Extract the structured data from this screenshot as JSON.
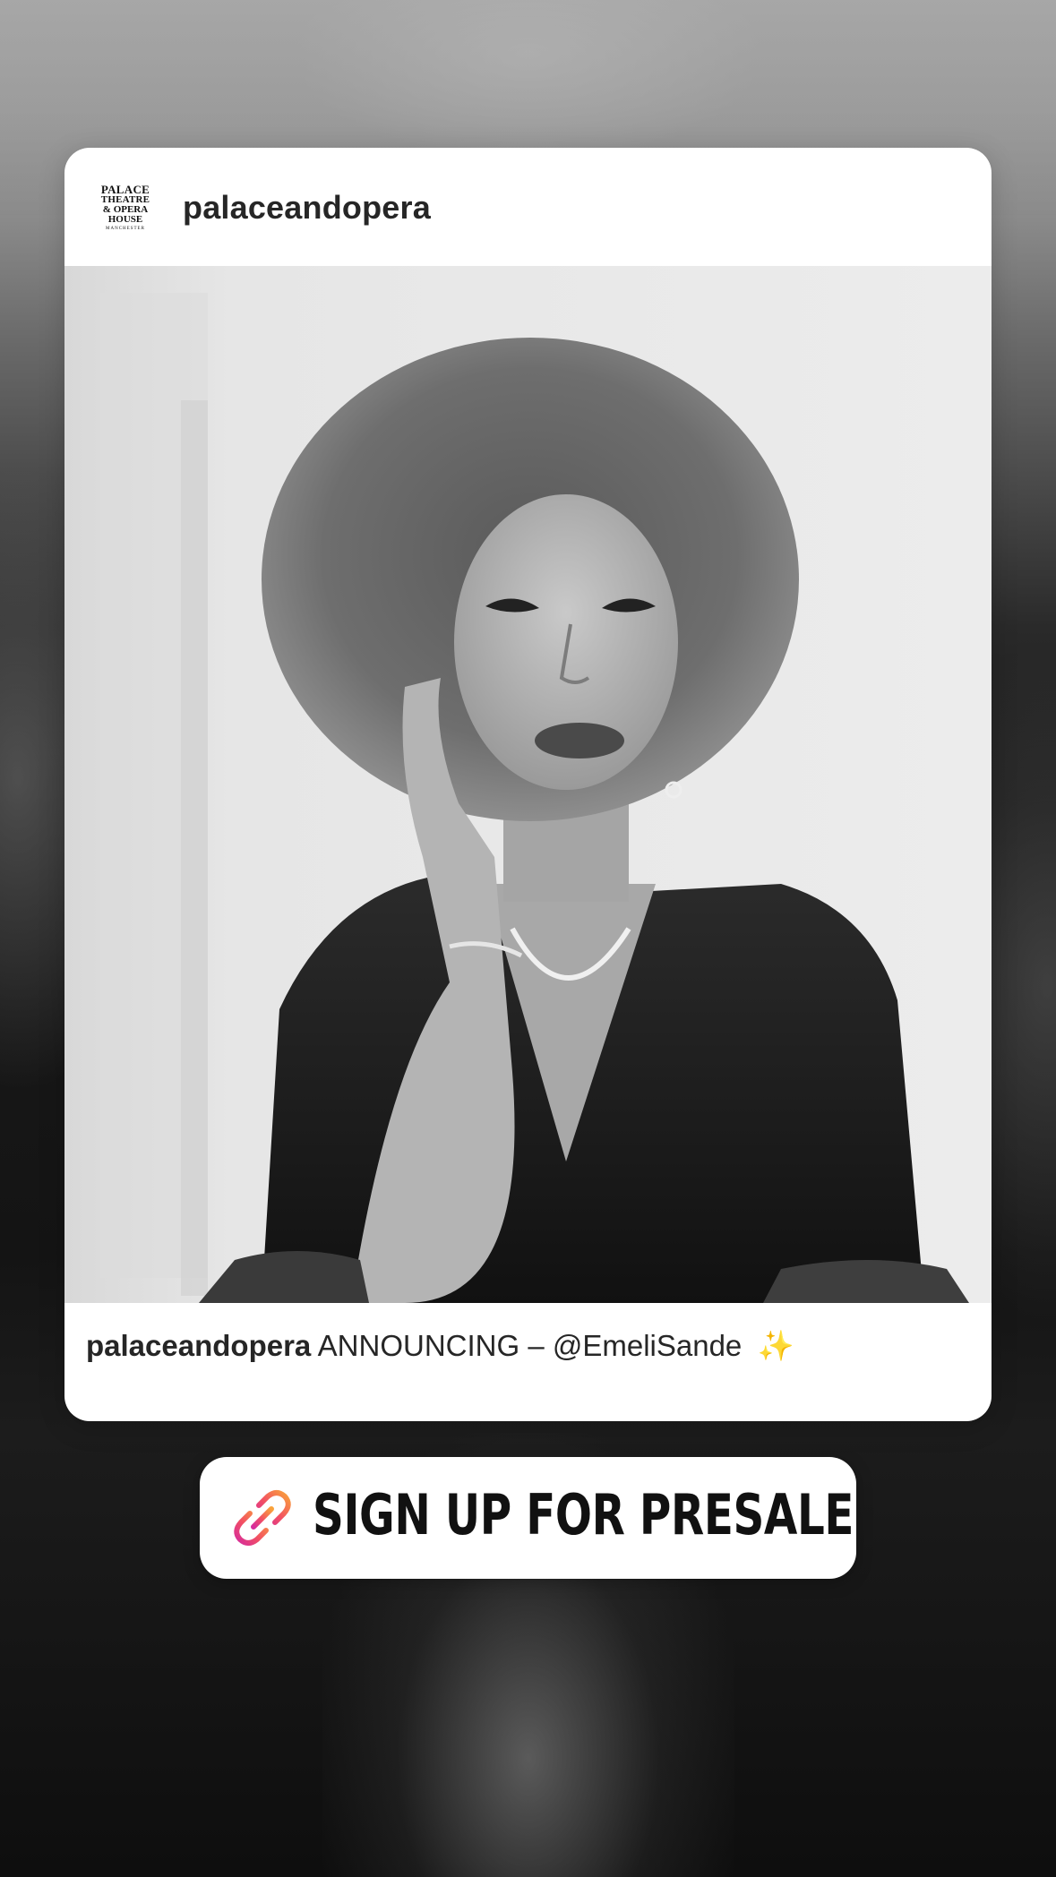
{
  "post": {
    "username": "palaceandopera",
    "logo_text": {
      "line1": "PALACE",
      "line2": "THEATRE",
      "line3": "& OPERA",
      "line4": "HOUSE",
      "line5": "MANCHESTER"
    },
    "caption_user": "palaceandopera",
    "caption_text": "ANNOUNCING – @EmeliSande",
    "caption_emoji": "✨"
  },
  "sticker": {
    "label": "SIGN UP FOR PRESALE",
    "icon": "link-icon"
  },
  "colors": {
    "card_bg": "#ffffff",
    "text_primary": "#262626",
    "link_gradient_start": "#f9a23b",
    "link_gradient_end": "#d62b9c"
  }
}
